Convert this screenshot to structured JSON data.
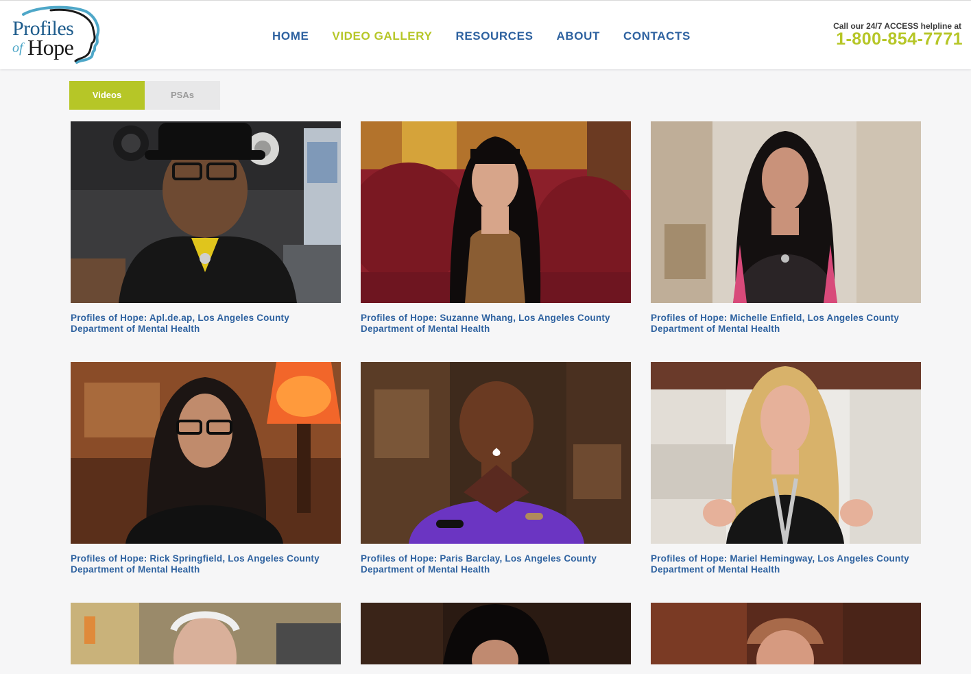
{
  "logo": {
    "line1": "Profiles",
    "of": "of",
    "line2": "Hope"
  },
  "nav": [
    {
      "label": "HOME",
      "active": false
    },
    {
      "label": "VIDEO GALLERY",
      "active": true
    },
    {
      "label": "RESOURCES",
      "active": false
    },
    {
      "label": "ABOUT",
      "active": false
    },
    {
      "label": "CONTACTS",
      "active": false
    }
  ],
  "helpline": {
    "label": "Call our 24/7 ACCESS helpline at",
    "number": "1-800-854-7771"
  },
  "tabs": [
    {
      "label": "Videos",
      "active": true
    },
    {
      "label": "PSAs",
      "active": false
    }
  ],
  "videos": [
    {
      "title": "Profiles of Hope: Apl.de.ap, Los Angeles County Department of Mental Health",
      "scene": "studio"
    },
    {
      "title": "Profiles of Hope: Suzanne Whang, Los Angeles County Department of Mental Health",
      "scene": "sofa"
    },
    {
      "title": "Profiles of Hope: Michelle Enfield, Los Angeles County Department of Mental Health",
      "scene": "room"
    },
    {
      "title": "Profiles of Hope: Rick Springfield, Los Angeles County Department of Mental Health",
      "scene": "lamp"
    },
    {
      "title": "Profiles of Hope: Paris Barclay, Los Angeles County Department of Mental Health",
      "scene": "purple"
    },
    {
      "title": "Profiles of Hope: Mariel Hemingway, Los Angeles County Department of Mental Health",
      "scene": "white"
    },
    {
      "title": "",
      "scene": "kitchen"
    },
    {
      "title": "",
      "scene": "dark"
    },
    {
      "title": "",
      "scene": "library"
    }
  ],
  "colors": {
    "brand_blue": "#2e62a0",
    "accent_green": "#b6c627"
  }
}
